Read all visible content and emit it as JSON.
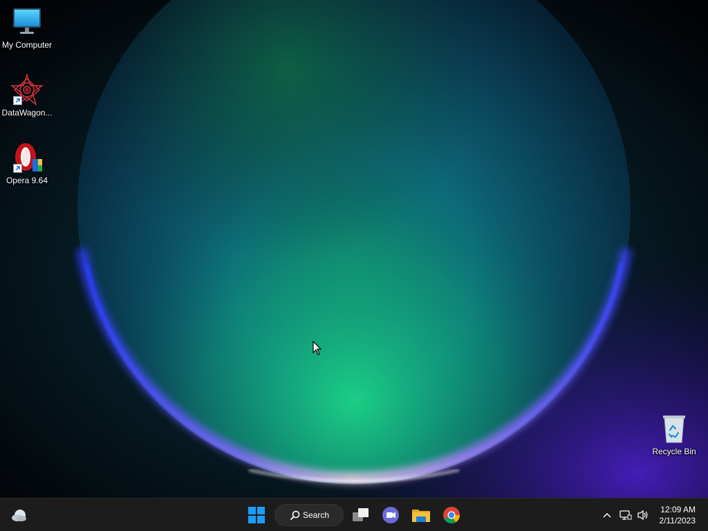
{
  "desktop": {
    "icons": [
      {
        "label": "My Computer"
      },
      {
        "label": "DataWagon..."
      },
      {
        "label": "Opera 9.64"
      },
      {
        "label": "Recycle Bin"
      }
    ]
  },
  "taskbar": {
    "search_label": "Search",
    "clock": {
      "time": "12:09 AM",
      "date": "2/11/2023"
    }
  },
  "colors": {
    "taskbar_bg": "#1c1c1c",
    "accent_blue": "#1e9bff",
    "folder_yellow": "#f5c33b"
  }
}
